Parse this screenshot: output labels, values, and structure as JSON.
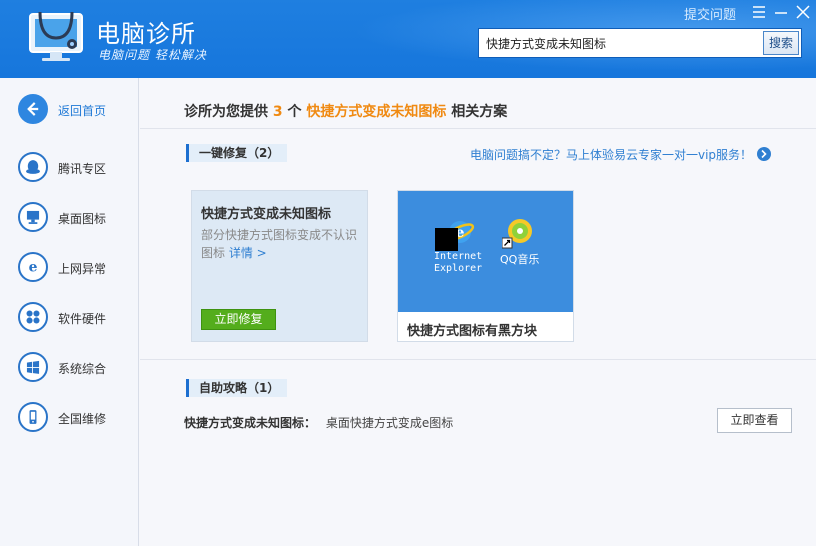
{
  "app": {
    "title": "电脑诊所",
    "subtitle": "电脑问题 轻松解决",
    "top_link": "提交问题",
    "accent_color": "#1f7fe0"
  },
  "search": {
    "value": "快捷方式变成未知图标",
    "button": "搜索"
  },
  "sidebar": {
    "items": [
      {
        "label": "返回首页",
        "icon": "back-arrow-icon"
      },
      {
        "label": "腾讯专区",
        "icon": "qq-penguin-icon"
      },
      {
        "label": "桌面图标",
        "icon": "monitor-icon"
      },
      {
        "label": "上网异常",
        "icon": "ie-browser-icon"
      },
      {
        "label": "软件硬件",
        "icon": "puzzle-icon"
      },
      {
        "label": "系统综合",
        "icon": "windows-logo-icon"
      },
      {
        "label": "全国维修",
        "icon": "phone-icon"
      }
    ]
  },
  "main": {
    "headline": {
      "prefix": "诊所为您提供",
      "count": "3",
      "unit": "个",
      "keyword": "快捷方式变成未知图标",
      "suffix": "相关方案"
    },
    "one_click": {
      "tag": "一键修复（2）",
      "promo": "电脑问题搞不定？马上体验易云专家一对一vip服务！"
    },
    "card1": {
      "title": "快捷方式变成未知图标",
      "desc": "部分快捷方式图标变成不认识图标",
      "more": "详情 >",
      "button": "立即修复"
    },
    "card2": {
      "title": "快捷方式图标有黑方块",
      "ie_label_line1": "Internet",
      "ie_label_line2": "Explorer",
      "qq_label": "QQ音乐"
    },
    "self_help": {
      "tag": "自助攻略（1）",
      "question": "快捷方式变成未知图标：",
      "answer": "桌面快捷方式变成e图标",
      "button": "立即查看"
    }
  }
}
